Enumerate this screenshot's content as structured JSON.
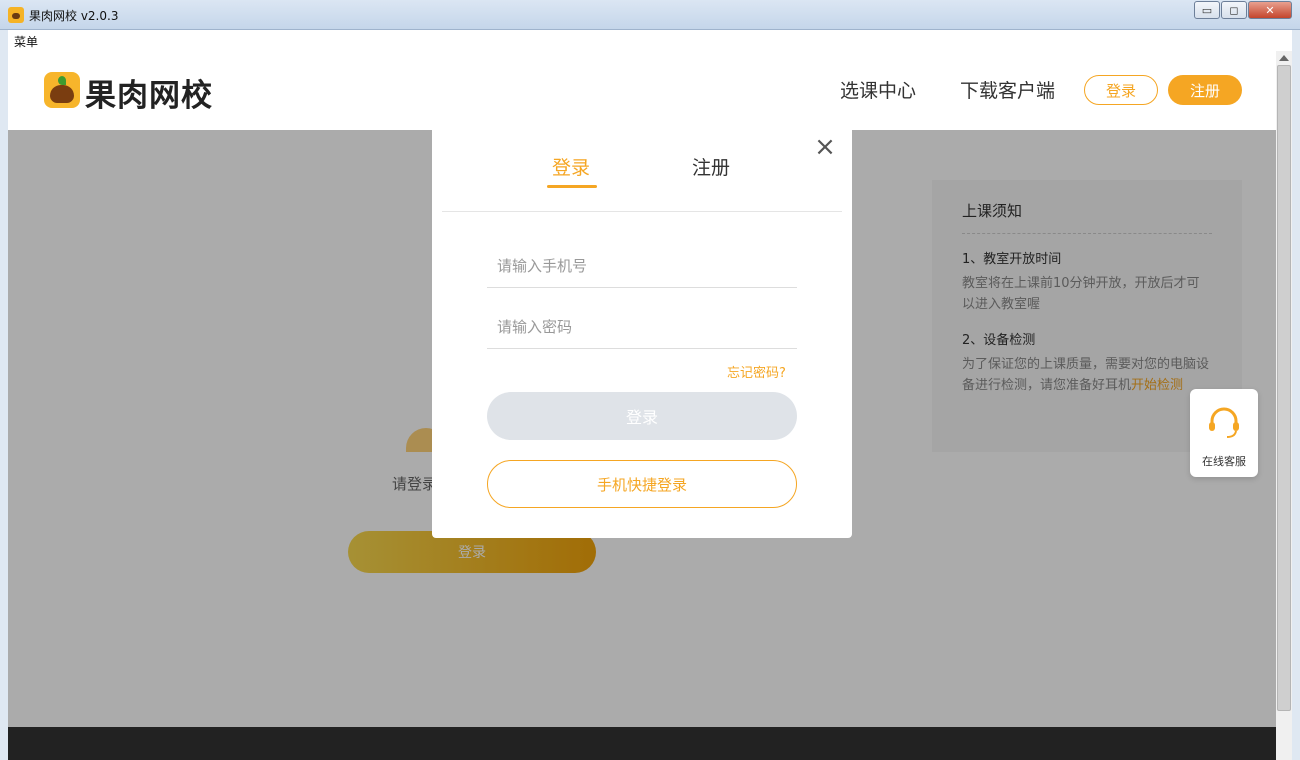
{
  "window": {
    "title": "果肉网校 v2.0.3",
    "minimize": "▭",
    "maximize": "◻",
    "close": "✕"
  },
  "menu": {
    "label": "菜单"
  },
  "header": {
    "logo_text": "果肉网校",
    "logo_badge": "果肉",
    "nav": [
      "选课中心",
      "下载客户端"
    ],
    "login_label": "登录",
    "register_label": "注册"
  },
  "notice": {
    "title": "上课须知",
    "item1_title": "1、教室开放时间",
    "item1_text": "教室将在上课前10分钟开放，开放后才可以进入教室喔",
    "item2_title": "2、设备检测",
    "item2_text": "为了保证您的上课质量，需要对您的电脑设备进行检测，请您准备好耳机",
    "item2_link": "开始检测"
  },
  "background": {
    "prompt": "请登录",
    "login_button": "登录"
  },
  "service": {
    "label": "在线客服"
  },
  "modal": {
    "close_icon": "×",
    "tab_login": "登录",
    "tab_register": "注册",
    "phone_placeholder": "请输入手机号",
    "password_placeholder": "请输入密码",
    "forgot": "忘记密码?",
    "login_button": "登录",
    "quick_login": "手机快捷登录"
  },
  "colors": {
    "accent": "#f5a623",
    "footer": "#333333"
  }
}
